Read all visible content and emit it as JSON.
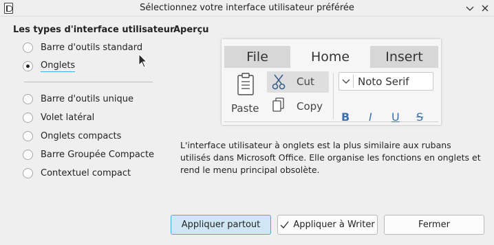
{
  "window": {
    "title": "Sélectionnez votre interface utilisateur préférée"
  },
  "ui_types": {
    "heading": "Les types d'interface utilisateur",
    "options_top": [
      {
        "label": "Barre d'outils standard",
        "checked": false
      },
      {
        "label": "Onglets",
        "checked": true
      }
    ],
    "options_bottom": [
      {
        "label": "Barre d'outils unique",
        "checked": false
      },
      {
        "label": "Volet latéral",
        "checked": false
      },
      {
        "label": "Onglets compacts",
        "checked": false
      },
      {
        "label": "Barre Groupée Compacte",
        "checked": false
      },
      {
        "label": "Contextuel compact",
        "checked": false
      }
    ]
  },
  "preview": {
    "heading": "Aperçu",
    "tabs": [
      "File",
      "Home",
      "Insert"
    ],
    "active_tab": "Home",
    "paste_label": "Paste",
    "cut_label": "Cut",
    "copy_label": "Copy",
    "font_name": "Noto Serif",
    "format_buttons": [
      "B",
      "I",
      "U",
      "S"
    ],
    "icon_names": [
      "paste-icon",
      "scissors-icon",
      "copy-icon",
      "chevron-down-icon"
    ]
  },
  "description": "L'interface utilisateur à onglets est la plus similaire aux rubans utilisés dans Microsoft Office. Elle organise les fonctions en onglets et rend le menu principal obsolète.",
  "buttons": {
    "apply_all": "Appliquer partout",
    "apply_writer": "Appliquer à Writer",
    "close": "Fermer"
  },
  "colors": {
    "accent": "#3daee9",
    "default_button_bg": "#cfe6f5",
    "preview_format_blue": "#3a6fb0"
  }
}
